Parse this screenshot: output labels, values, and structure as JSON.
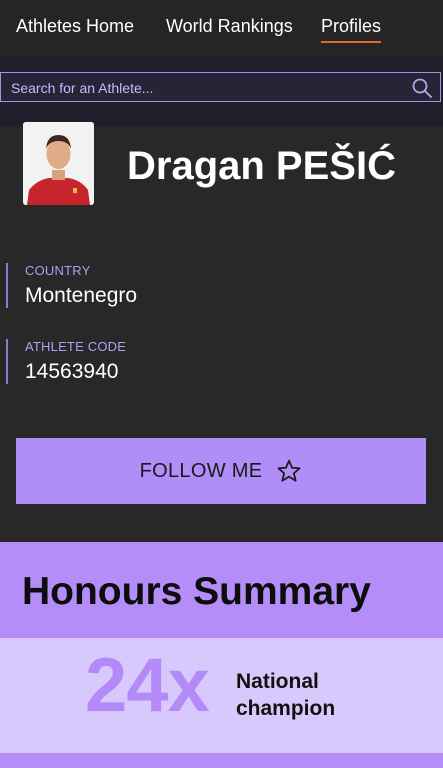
{
  "nav": {
    "items": [
      {
        "label": "Athletes Home",
        "active": false
      },
      {
        "label": "World Rankings",
        "active": false
      },
      {
        "label": "Profiles",
        "active": true
      }
    ],
    "active_underline_color": "#e46a2c"
  },
  "search": {
    "placeholder": "Search for an Athlete...",
    "icon": "search-icon"
  },
  "athlete": {
    "name": "Dragan PEŠIĆ",
    "country_label": "COUNTRY",
    "country": "Montenegro",
    "code_label": "ATHLETE CODE",
    "code": "14563940"
  },
  "follow": {
    "label": "FOLLOW ME",
    "icon": "star-outline-icon"
  },
  "honours": {
    "title": "Honours Summary",
    "count": "24x",
    "label": "National champion"
  },
  "colors": {
    "accent": "#b08df7",
    "background": "#282828",
    "honours_light": "#d8c9fc"
  }
}
